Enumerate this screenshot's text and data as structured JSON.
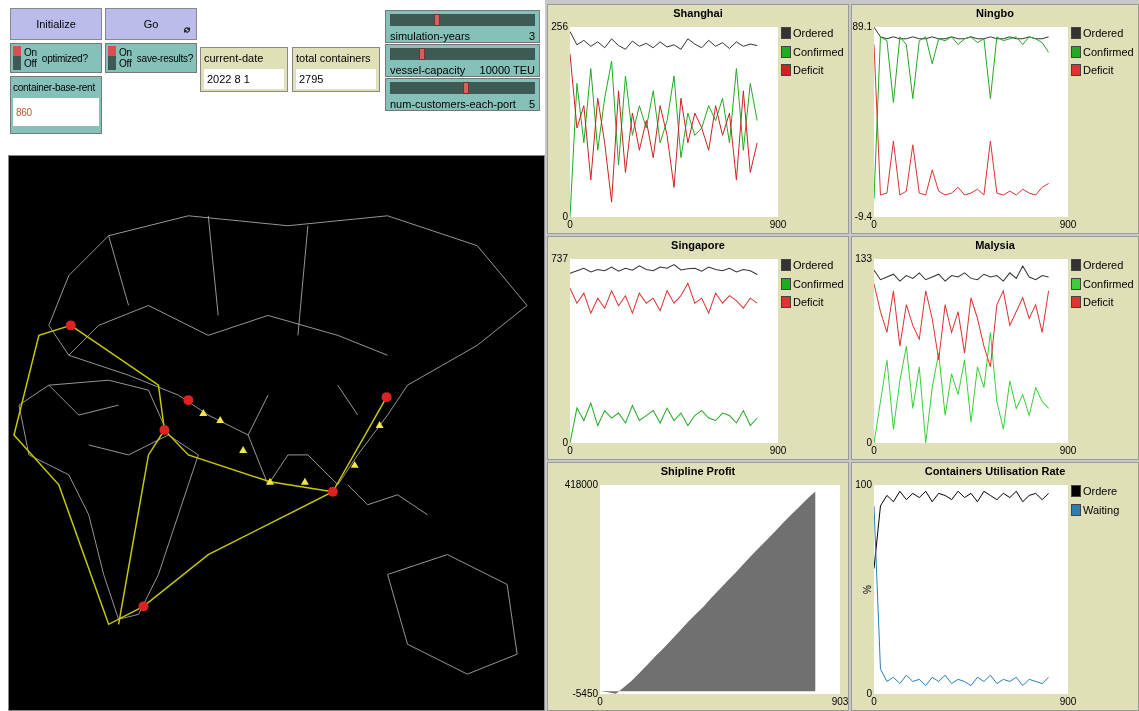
{
  "buttons": [
    {
      "label": "Initialize",
      "forever": false
    },
    {
      "label": "Go",
      "forever": true
    }
  ],
  "switches": [
    {
      "label": "optimized?",
      "on_label": "On",
      "off_label": "Off",
      "on": true
    },
    {
      "label": "save-results?",
      "on_label": "On",
      "off_label": "Off",
      "on": true
    }
  ],
  "input": {
    "label": "container-base-rent",
    "value": "860"
  },
  "monitors": [
    {
      "label": "current-date",
      "value": "2022 8 1"
    },
    {
      "label": "total containers",
      "value": "2795"
    }
  ],
  "sliders": [
    {
      "label": "simulation-years",
      "value": "3",
      "level": 0.3
    },
    {
      "label": "vessel-capacity",
      "value": "10000 TEU",
      "level": 0.2
    },
    {
      "label": "num-customers-each-port",
      "value": "5",
      "level": 0.5
    }
  ],
  "plots": [
    {
      "chart_data": {
        "type": "line",
        "title": "Shanghai",
        "legend": "right",
        "x": [
          0,
          30,
          60,
          90,
          120,
          150,
          180,
          210,
          240,
          270,
          300,
          330,
          360,
          390,
          420,
          450,
          480,
          510,
          540,
          570,
          600,
          630,
          660,
          690,
          720,
          750,
          780,
          810
        ],
        "xlim": [
          0,
          900
        ],
        "ylim": [
          0,
          256
        ],
        "xticks": [
          0,
          900
        ],
        "yticks": [
          0,
          256
        ],
        "series": [
          {
            "name": "Ordered",
            "color": "#333333",
            "values": [
              250,
              232,
              238,
              230,
              236,
              228,
              240,
              231,
              226,
              237,
              230,
              234,
              228,
              236,
              229,
              232,
              226,
              240,
              233,
              228,
              238,
              230,
              235,
              227,
              236,
              230,
              233,
              231
            ]
          },
          {
            "name": "Confirmed",
            "color": "#22aa22",
            "values": [
              0,
              180,
              100,
              200,
              90,
              160,
              210,
              70,
              190,
              110,
              150,
              120,
              170,
              100,
              130,
              190,
              80,
              140,
              110,
              120,
              150,
              130,
              160,
              100,
              200,
              90,
              180,
              130
            ]
          },
          {
            "name": "Deficit",
            "color": "#cc2222",
            "values": [
              220,
              120,
              150,
              50,
              160,
              100,
              20,
              170,
              60,
              140,
              90,
              130,
              80,
              150,
              110,
              40,
              160,
              100,
              140,
              120,
              90,
              150,
              110,
              140,
              50,
              170,
              60,
              100
            ]
          }
        ]
      }
    },
    {
      "chart_data": {
        "type": "line",
        "title": "Ningbo",
        "legend": "right",
        "x": [
          0,
          30,
          60,
          90,
          120,
          150,
          180,
          210,
          240,
          270,
          300,
          330,
          360,
          390,
          420,
          450,
          480,
          510,
          540,
          570,
          600,
          630,
          660,
          690,
          720,
          750,
          780,
          810
        ],
        "xlim": [
          0,
          900
        ],
        "ylim": [
          -9.4,
          89.1
        ],
        "xticks": [
          0,
          900
        ],
        "yticks": [
          -9.4,
          89.1
        ],
        "series": [
          {
            "name": "Ordered",
            "color": "#333333",
            "values": [
              89,
              84,
              83,
              84,
              83,
              83,
              84,
              83,
              83,
              84,
              83,
              83,
              84,
              83,
              83,
              84,
              83,
              83,
              84,
              83,
              83,
              84,
              83,
              83,
              84,
              83,
              83,
              84
            ]
          },
          {
            "name": "Confirmed",
            "color": "#22aa22",
            "values": [
              0,
              84,
              82,
              50,
              84,
              80,
              52,
              82,
              84,
              70,
              83,
              82,
              84,
              80,
              83,
              84,
              81,
              83,
              52,
              84,
              82,
              83,
              84,
              80,
              84,
              83,
              81,
              76
            ]
          },
          {
            "name": "Deficit",
            "color": "#dd3333",
            "values": [
              80,
              2,
              3,
              30,
              2,
              4,
              28,
              3,
              2,
              15,
              4,
              2,
              3,
              6,
              2,
              3,
              5,
              2,
              30,
              3,
              2,
              4,
              2,
              5,
              3,
              2,
              6,
              8
            ]
          }
        ]
      }
    },
    {
      "chart_data": {
        "type": "line",
        "title": "Singapore",
        "legend": "right",
        "x": [
          0,
          30,
          60,
          90,
          120,
          150,
          180,
          210,
          240,
          270,
          300,
          330,
          360,
          390,
          420,
          450,
          480,
          510,
          540,
          570,
          600,
          630,
          660,
          690,
          720,
          750,
          780,
          810
        ],
        "xlim": [
          0,
          900
        ],
        "ylim": [
          0,
          737
        ],
        "xticks": [
          0,
          900
        ],
        "yticks": [
          0,
          737
        ],
        "series": [
          {
            "name": "Ordered",
            "color": "#333333",
            "values": [
              680,
              690,
              700,
              685,
              695,
              690,
              705,
              688,
              700,
              692,
              710,
              695,
              690,
              705,
              700,
              715,
              693,
              698,
              700,
              688,
              705,
              695,
              690,
              700,
              685,
              695,
              690,
              675
            ]
          },
          {
            "name": "Confirmed",
            "color": "#22aa22",
            "values": [
              0,
              140,
              90,
              160,
              70,
              130,
              100,
              120,
              80,
              150,
              90,
              110,
              130,
              80,
              140,
              90,
              120,
              70,
              110,
              130,
              100,
              90,
              120,
              110,
              80,
              130,
              70,
              100
            ]
          },
          {
            "name": "Deficit",
            "color": "#dd3333",
            "values": [
              620,
              560,
              600,
              520,
              580,
              540,
              610,
              550,
              590,
              520,
              600,
              560,
              580,
              530,
              610,
              560,
              590,
              640,
              560,
              580,
              520,
              600,
              560,
              590,
              570,
              540,
              580,
              560
            ]
          }
        ]
      }
    },
    {
      "chart_data": {
        "type": "line",
        "title": "Malysia",
        "legend": "right",
        "x": [
          0,
          30,
          60,
          90,
          120,
          150,
          180,
          210,
          240,
          270,
          300,
          330,
          360,
          390,
          420,
          450,
          480,
          510,
          540,
          570,
          600,
          630,
          660,
          690,
          720,
          750,
          780,
          810
        ],
        "xlim": [
          0,
          900
        ],
        "ylim": [
          0,
          133
        ],
        "xticks": [
          0,
          900
        ],
        "yticks": [
          0,
          133
        ],
        "series": [
          {
            "name": "Ordered",
            "color": "#333333",
            "values": [
              125,
              118,
              120,
              122,
              117,
              121,
              119,
              123,
              118,
              120,
              122,
              117,
              121,
              120,
              123,
              119,
              118,
              122,
              120,
              121,
              117,
              123,
              119,
              128,
              120,
              118,
              121,
              120
            ]
          },
          {
            "name": "Confirmed",
            "color": "#3ccf3c",
            "values": [
              0,
              30,
              60,
              10,
              45,
              70,
              25,
              55,
              0,
              40,
              65,
              20,
              50,
              35,
              60,
              15,
              55,
              40,
              80,
              30,
              10,
              45,
              25,
              35,
              20,
              40,
              30,
              25
            ]
          },
          {
            "name": "Deficit",
            "color": "#dd3333",
            "values": [
              115,
              95,
              80,
              110,
              70,
              100,
              85,
              75,
              110,
              90,
              60,
              100,
              80,
              95,
              65,
              105,
              90,
              70,
              55,
              100,
              110,
              85,
              95,
              105,
              90,
              100,
              80,
              110
            ]
          }
        ]
      }
    },
    {
      "chart_data": {
        "type": "area",
        "title": "Shipline Profit",
        "x": [
          0,
          30,
          60,
          90,
          120,
          150,
          180,
          210,
          240,
          270,
          300,
          330,
          360,
          390,
          420,
          450,
          480,
          510,
          540,
          570,
          600,
          630,
          660,
          690,
          720,
          750,
          780,
          810
        ],
        "xlim": [
          0,
          903
        ],
        "ylim": [
          -5450,
          418000
        ],
        "xticks": [
          0,
          903
        ],
        "yticks": [
          -5450,
          418000
        ],
        "series": [
          {
            "color": "#707070",
            "values": [
              0,
              -2000,
              -5000,
              8000,
              22000,
              38000,
              55000,
              72000,
              88000,
              105000,
              122000,
              140000,
              156000,
              172000,
              190000,
              207000,
              224000,
              240000,
              258000,
              275000,
              292000,
              308000,
              325000,
              342000,
              358000,
              374000,
              390000,
              405000
            ]
          }
        ]
      }
    },
    {
      "chart_data": {
        "type": "line",
        "title": "Containers Utilisation Rate",
        "legend": "right",
        "ylabel": "%",
        "x": [
          0,
          30,
          60,
          90,
          120,
          150,
          180,
          210,
          240,
          270,
          300,
          330,
          360,
          390,
          420,
          450,
          480,
          510,
          540,
          570,
          600,
          630,
          660,
          690,
          720,
          750,
          780,
          810
        ],
        "xlim": [
          0,
          900
        ],
        "ylim": [
          0,
          100
        ],
        "xticks": [
          0,
          900
        ],
        "yticks": [
          0,
          100
        ],
        "series": [
          {
            "name": "Ordere",
            "color": "#000000",
            "values": [
              60,
              90,
              95,
              92,
              97,
              93,
              96,
              94,
              97,
              92,
              96,
              95,
              93,
              97,
              94,
              96,
              92,
              97,
              95,
              93,
              96,
              94,
              97,
              92,
              95,
              96,
              93,
              96
            ]
          },
          {
            "name": "Waiting",
            "color": "#2a7fb0",
            "values": [
              90,
              12,
              6,
              8,
              5,
              9,
              6,
              7,
              4,
              8,
              6,
              9,
              5,
              7,
              6,
              4,
              8,
              6,
              9,
              5,
              7,
              6,
              8,
              4,
              7,
              6,
              5,
              8
            ]
          }
        ]
      }
    }
  ]
}
